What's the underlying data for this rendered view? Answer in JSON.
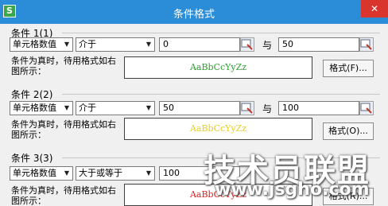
{
  "window": {
    "title": "条件格式",
    "app_icon": "S",
    "close_glyph": "✕"
  },
  "conditions": [
    {
      "label": "条件 1(1)",
      "type": "单元格数值",
      "operator": "介于",
      "value1": "0",
      "and_label": "与",
      "value2": "50",
      "note": "条件为真时，待用格式如右图所示：",
      "preview_text": "AaBbCcYyZz",
      "preview_color": "#2ea02e",
      "format_button": "格式(F)..."
    },
    {
      "label": "条件 2(2)",
      "type": "单元格数值",
      "operator": "介于",
      "value1": "50",
      "and_label": "与",
      "value2": "100",
      "note": "条件为真时，待用格式如右图所示：",
      "preview_text": "AaBbCcYyZz",
      "preview_color": "#e8d020",
      "format_button": "格式(O)..."
    },
    {
      "label": "条件 3(3)",
      "type": "单元格数值",
      "operator": "大于或等于",
      "value1": "100",
      "note": "条件为真时，待用格式如右图所示：",
      "preview_text": "AaBbCcYyZz",
      "preview_color": "#e02020",
      "format_button": "格式(R)..."
    }
  ],
  "watermark": {
    "main": "技术员联盟",
    "url": "www.jsgho.com"
  }
}
